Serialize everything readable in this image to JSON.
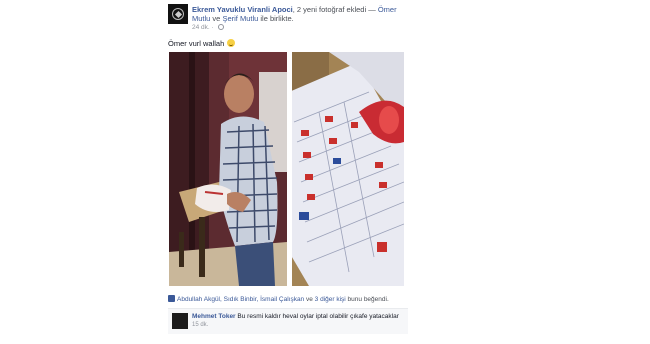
{
  "post": {
    "author": "Ekrem Yavuklu Viranli Apoci",
    "action": ", 2 yeni fotoğraf ekledi",
    "with_separator": " — ",
    "with_person_1": "Ömer Mutlu",
    "with_joiner": " ve ",
    "with_person_2": "Şerif Mutlu",
    "with_suffix": " ile birlikte.",
    "time": "24 dk.",
    "meta_separator": " · ",
    "caption": "Ömer vurl wallah",
    "likes_names": "Abdullah Akgül, Sıdık Binbir, İsmail Çalışkan",
    "likes_joiner": " ve ",
    "likes_others": "3 diğer kişi",
    "likes_suffix": " bunu beğendi."
  },
  "comment": {
    "author": "Mehmet Toker",
    "text": "Bu resmi kaldır heval oylar iptal olabilir çıkafe yatacaklar",
    "time": "15 dk."
  },
  "icons": {
    "avatar": "page-logo-icon",
    "globe": "globe-icon",
    "smile": "smile-emoji-icon",
    "like": "like-thumb-icon"
  },
  "colors": {
    "link": "#3b5998",
    "meta": "#90949c",
    "comment_bg": "#f6f7f9"
  }
}
